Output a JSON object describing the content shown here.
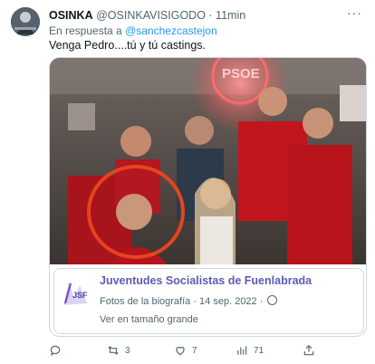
{
  "tweet": {
    "name": "OSINKA",
    "handle": "@OSINKAVISIGODO",
    "time": "· 11min",
    "menu_icon": "more-dots-icon",
    "reply_prefix": "En respuesta a",
    "reply_mention": "@sanchezcastejon",
    "text": "Venga Pedro....tú y tú castings."
  },
  "photo": {
    "neon_sign_text": "PSOE"
  },
  "embed": {
    "title": "Juventudes Socialistas de Fuenlabrada",
    "subtitle": "Fotos de la biografía · 14 sep. 2022 ·",
    "globe_icon": "globe-icon",
    "link": "Ver en tamaño grande",
    "logo_text": "JSF"
  },
  "actions": {
    "reply_icon": "reply-icon",
    "retweet_icon": "retweet-icon",
    "retweet_count": "3",
    "like_icon": "heart-icon",
    "like_count": "7",
    "views_icon": "views-chart-icon",
    "views_count": "71",
    "share_icon": "share-icon"
  },
  "colors": {
    "link": "#1d9bf0",
    "muted": "#536471",
    "embed_title": "#5b5bb8",
    "highlight_circle": "#e8431f"
  }
}
